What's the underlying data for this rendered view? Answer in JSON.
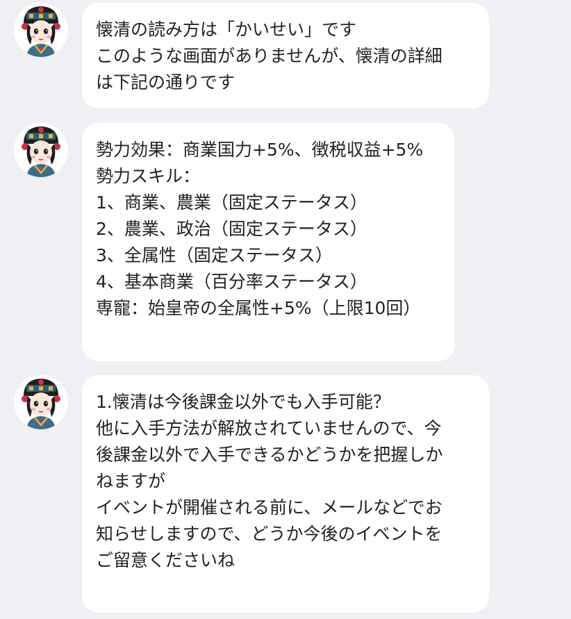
{
  "chat": {
    "messages": [
      {
        "sender": "assistant",
        "avatar_icon": "empress-avatar-icon",
        "lines": [
          "懐清の読み方は「かいせい」です",
          "このような画面がありませんが、懐清の詳細",
          "は下記の通りです"
        ]
      },
      {
        "sender": "assistant",
        "avatar_icon": "empress-avatar-icon",
        "lines": [
          "勢力効果：商業国力+5%、徴税収益+5%",
          "勢力スキル：",
          "1、商業、農業（固定ステータス）",
          "2、農業、政治（固定ステータス）",
          "3、全属性（固定ステータス）",
          "4、基本商業（百分率ステータス）",
          "専寵：始皇帝の全属性+5%（上限10回）"
        ]
      },
      {
        "sender": "assistant",
        "avatar_icon": "empress-avatar-icon",
        "lines": [
          "1.懐清は今後課金以外でも入手可能？",
          "他に入手方法が解放されていませんので、今",
          "後課金以外で入手できるかどうかを把握しか",
          "ねますが",
          "イベントが開催される前に、メールなどでお",
          "知らせしますので、どうか今後のイベントを",
          "ご留意くださいね"
        ]
      }
    ]
  },
  "colors": {
    "background": "#efeff4",
    "bubble": "#ffffff",
    "text": "#222222"
  }
}
